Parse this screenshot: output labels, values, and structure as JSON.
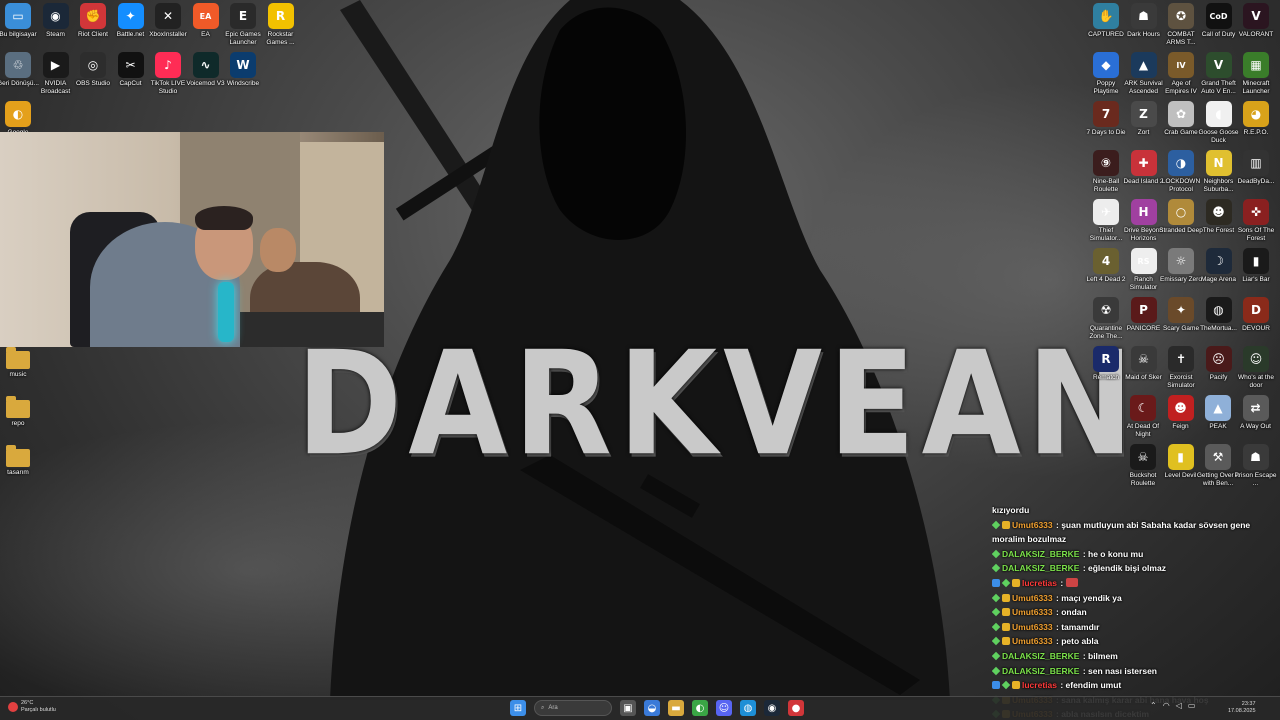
{
  "wallpaper": {
    "title": "DARKVEAN"
  },
  "desktop_left": [
    {
      "label": "Bu bilgisayar",
      "icon": "monitor-icon",
      "color": "#3a8ed8",
      "glyph": "▭"
    },
    {
      "label": "Steam",
      "icon": "steam-icon",
      "color": "#1b2838",
      "glyph": "◉"
    },
    {
      "label": "Riot Client",
      "icon": "riot-icon",
      "color": "#d13639",
      "glyph": "✊"
    },
    {
      "label": "Battle.net",
      "icon": "battlenet-icon",
      "color": "#148eff",
      "glyph": "✦"
    },
    {
      "label": "XboxInstaller",
      "icon": "xbox-icon",
      "color": "#222222",
      "glyph": "✕"
    },
    {
      "label": "EA",
      "icon": "ea-icon",
      "color": "#f05a28",
      "glyph": "EA"
    },
    {
      "label": "Epic Games Launcher",
      "icon": "epic-icon",
      "color": "#2a2a2a",
      "glyph": "E"
    },
    {
      "label": "Rockstar Games ...",
      "icon": "rockstar-icon",
      "color": "#f2c100",
      "glyph": "R"
    },
    {
      "label": "Geri Dönüşü...",
      "icon": "recycle-bin-icon",
      "color": "#5a6e80",
      "glyph": "♲"
    },
    {
      "label": "NVIDIA Broadcast",
      "icon": "nvidia-icon",
      "color": "#1a1a1a",
      "glyph": "▶"
    },
    {
      "label": "OBS Studio",
      "icon": "obs-icon",
      "color": "#2d2d2d",
      "glyph": "◎"
    },
    {
      "label": "CapCut",
      "icon": "capcut-icon",
      "color": "#111111",
      "glyph": "✂"
    },
    {
      "label": "TikTok LIVE Studio",
      "icon": "tiktok-icon",
      "color": "#ff2c55",
      "glyph": "♪"
    },
    {
      "label": "Voicemod V3",
      "icon": "voicemod-icon",
      "color": "#0f2a2a",
      "glyph": "∿"
    },
    {
      "label": "Windscribe",
      "icon": "windscribe-icon",
      "color": "#0b3c6e",
      "glyph": "W"
    },
    {
      "label": "Google",
      "icon": "chrome-icon",
      "color": "#e4a01b",
      "glyph": "◐"
    },
    {
      "label": "music",
      "icon": "folder-icon",
      "color": "#d9a93d",
      "glyph": ""
    },
    {
      "label": "repo",
      "icon": "folder-icon",
      "color": "#d9a93d",
      "glyph": ""
    },
    {
      "label": "tasarım",
      "icon": "folder-icon",
      "color": "#d9a93d",
      "glyph": ""
    }
  ],
  "desktop_right": [
    {
      "label": "CAPTURED",
      "icon": "captured-icon",
      "color": "#2f7fa0",
      "glyph": "✋"
    },
    {
      "label": "Dark Hours",
      "icon": "dark-hours-icon",
      "color": "#3a3a3a",
      "glyph": "☗"
    },
    {
      "label": "COMBAT ARMS T...",
      "icon": "combat-arms-icon",
      "color": "#5e5240",
      "glyph": "✪"
    },
    {
      "label": "Call of Duty",
      "icon": "cod-icon",
      "color": "#111111",
      "glyph": "CoD"
    },
    {
      "label": "VALORANT",
      "icon": "valorant-icon",
      "color": "#2b1520",
      "glyph": "V"
    },
    {
      "label": "Poppy Playtime",
      "icon": "poppy-icon",
      "color": "#2a6fd6",
      "glyph": "◆"
    },
    {
      "label": "ARK Survival Ascended",
      "icon": "ark-icon",
      "color": "#1b3a5c",
      "glyph": "▲"
    },
    {
      "label": "Age of Empires IV",
      "icon": "aoe-icon",
      "color": "#7a5a2a",
      "glyph": "IV"
    },
    {
      "label": "Grand Theft Auto V En...",
      "icon": "gta-icon",
      "color": "#2d4d2d",
      "glyph": "V"
    },
    {
      "label": "Minecraft Launcher",
      "icon": "minecraft-icon",
      "color": "#3a7d2a",
      "glyph": "▦"
    },
    {
      "label": "7 Days to Die",
      "icon": "7days-icon",
      "color": "#6a2a1e",
      "glyph": "7"
    },
    {
      "label": "Zort",
      "icon": "zort-icon",
      "color": "#4a4a4a",
      "glyph": "Z"
    },
    {
      "label": "Crab Game",
      "icon": "crab-game-icon",
      "color": "#bfbfbf",
      "glyph": "✿"
    },
    {
      "label": "Goose Goose Duck",
      "icon": "goose-icon",
      "color": "#f0f0f0",
      "glyph": "◖"
    },
    {
      "label": "R.E.P.O.",
      "icon": "repo-game-icon",
      "color": "#d8a21a",
      "glyph": "◕"
    },
    {
      "label": "Nine-Ball Roulette",
      "icon": "nineball-icon",
      "color": "#3b1d1d",
      "glyph": "⑨"
    },
    {
      "label": "Dead Island 2",
      "icon": "dead-island-icon",
      "color": "#c8323a",
      "glyph": "✚"
    },
    {
      "label": "LOCKDOWN Protocol",
      "icon": "lockdown-icon",
      "color": "#2c5fa0",
      "glyph": "◑"
    },
    {
      "label": "Neighbors Suburba...",
      "icon": "neighbors-icon",
      "color": "#e0c030",
      "glyph": "N"
    },
    {
      "label": "DeadByDa...",
      "icon": "dbd-icon",
      "color": "#333333",
      "glyph": "▥"
    },
    {
      "label": "Thief Simulator...",
      "icon": "thief-icon",
      "color": "#ededed",
      "glyph": "✈"
    },
    {
      "label": "Drive Beyond Horizons",
      "icon": "drive-beyond-icon",
      "color": "#a040a0",
      "glyph": "H"
    },
    {
      "label": "Stranded Deep",
      "icon": "stranded-icon",
      "color": "#b08a3a",
      "glyph": "○"
    },
    {
      "label": "The Forest",
      "icon": "forest-icon",
      "color": "#2d2a22",
      "glyph": "☻"
    },
    {
      "label": "Sons Of The Forest",
      "icon": "sons-forest-icon",
      "color": "#8a2020",
      "glyph": "✜"
    },
    {
      "label": "Left 4 Dead 2",
      "icon": "l4d2-icon",
      "color": "#6a6030",
      "glyph": "4"
    },
    {
      "label": "Ranch Simulator",
      "icon": "ranch-icon",
      "color": "#eeeeee",
      "glyph": "RS"
    },
    {
      "label": "Emissary Zero",
      "icon": "emissary-icon",
      "color": "#7a7a7a",
      "glyph": "☼"
    },
    {
      "label": "Mage Arena",
      "icon": "mage-arena-icon",
      "color": "#1e2a3a",
      "glyph": "☽"
    },
    {
      "label": "Liar's Bar",
      "icon": "liars-bar-icon",
      "color": "#1a1a1a",
      "glyph": "▮"
    },
    {
      "label": "Quarantine Zone The...",
      "icon": "quarantine-icon",
      "color": "#3a3a3a",
      "glyph": "☢"
    },
    {
      "label": "PANICORE",
      "icon": "panicore-icon",
      "color": "#5a1a1a",
      "glyph": "P"
    },
    {
      "label": "Scary Game",
      "icon": "scary-game-icon",
      "color": "#6a4a2a",
      "glyph": "✦"
    },
    {
      "label": "TheMortua...",
      "icon": "mortuary-icon",
      "color": "#1a1a1a",
      "glyph": "◍"
    },
    {
      "label": "DEVOUR",
      "icon": "devour-icon",
      "color": "#8a2a1a",
      "glyph": "D"
    },
    {
      "label": "Rematch",
      "icon": "rematch-icon",
      "color": "#1a2a6a",
      "glyph": "R"
    },
    {
      "label": "Maid of Sker",
      "icon": "maid-sker-icon",
      "color": "#3a3a3a",
      "glyph": "☠"
    },
    {
      "label": "Exorcist Simulator",
      "icon": "exorcist-icon",
      "color": "#2a2a2a",
      "glyph": "✝"
    },
    {
      "label": "Pacify",
      "icon": "pacify-icon",
      "color": "#4a1a1a",
      "glyph": "☹"
    },
    {
      "label": "Who's at the door",
      "icon": "whos-door-icon",
      "color": "#2a3a2a",
      "glyph": "☺"
    },
    {
      "label": "At Dead Of Night",
      "icon": "dead-night-icon",
      "color": "#6a1a1a",
      "glyph": "☾"
    },
    {
      "label": "Feign",
      "icon": "feign-icon",
      "color": "#c02020",
      "glyph": "☻"
    },
    {
      "label": "PEAK",
      "icon": "peak-icon",
      "color": "#8fb0d8",
      "glyph": "▲"
    },
    {
      "label": "A Way Out",
      "icon": "way-out-icon",
      "color": "#5a5a5a",
      "glyph": "⇄"
    },
    {
      "label": "Buckshot Roulette",
      "icon": "buckshot-icon",
      "color": "#1a1a1a",
      "glyph": "☠"
    },
    {
      "label": "Level Devil",
      "icon": "level-devil-icon",
      "color": "#e0c020",
      "glyph": "▮"
    },
    {
      "label": "Getting Over It with Ben...",
      "icon": "getting-over-icon",
      "color": "#5a5a5a",
      "glyph": "⚒"
    },
    {
      "label": "Prison Escape ...",
      "icon": "prison-escape-icon",
      "color": "#3a3a3a",
      "glyph": "☗"
    }
  ],
  "chat": [
    {
      "user": "",
      "text": "kızıyordu",
      "badges": [],
      "color": "#ffffff"
    },
    {
      "user": "Umut6333",
      "text": ": şuan mutluyum abi Sabaha kadar sövsen gene moralim bozulmaz",
      "badges": [
        "green",
        "gold"
      ],
      "color": "#f0a030"
    },
    {
      "user": "DALAKSIZ_BERKE",
      "text": ": he o konu mu",
      "badges": [
        "green"
      ],
      "color": "#7be04a"
    },
    {
      "user": "DALAKSIZ_BERKE",
      "text": ": eğlendik bişi olmaz",
      "badges": [
        "green"
      ],
      "color": "#7be04a"
    },
    {
      "user": "lucretias",
      "text": ":",
      "badges": [
        "blue",
        "green",
        "gold"
      ],
      "color": "#ff3a3a",
      "emote": true
    },
    {
      "user": "Umut6333",
      "text": ": maçı yendik ya",
      "badges": [
        "green",
        "gold"
      ],
      "color": "#f0a030"
    },
    {
      "user": "Umut6333",
      "text": ": ondan",
      "badges": [
        "green",
        "gold"
      ],
      "color": "#f0a030"
    },
    {
      "user": "Umut6333",
      "text": ": tamamdır",
      "badges": [
        "green",
        "gold"
      ],
      "color": "#f0a030"
    },
    {
      "user": "Umut6333",
      "text": ": peto abla",
      "badges": [
        "green",
        "gold"
      ],
      "color": "#f0a030"
    },
    {
      "user": "DALAKSIZ_BERKE",
      "text": ": bilmem",
      "badges": [
        "green"
      ],
      "color": "#7be04a"
    },
    {
      "user": "DALAKSIZ_BERKE",
      "text": ": sen nası istersen",
      "badges": [
        "green"
      ],
      "color": "#7be04a"
    },
    {
      "user": "lucretias",
      "text": ": efendim umut",
      "badges": [
        "blue",
        "green",
        "gold"
      ],
      "color": "#ff3a3a"
    },
    {
      "user": "Umut6333",
      "text": ": sana kalmış karar abi bana hava hoş",
      "badges": [
        "green",
        "gold"
      ],
      "color": "#f0a030"
    },
    {
      "user": "Umut6333",
      "text": ": abla nasılsın dicektim",
      "badges": [
        "green",
        "gold"
      ],
      "color": "#f0a030"
    }
  ],
  "taskbar": {
    "weather_temp": "26°C",
    "weather_desc": "Parçalı bulutlu",
    "search_placeholder": "Ara",
    "time": "23:37",
    "date": "17.08.2025",
    "apps": [
      {
        "name": "start-button",
        "glyph": "⊞",
        "color": "#3c8ee8"
      },
      {
        "name": "taskview-button",
        "glyph": "▣",
        "color": "#555555"
      },
      {
        "name": "widgets-button",
        "glyph": "◒",
        "color": "#3a7ad8"
      },
      {
        "name": "file-explorer-button",
        "glyph": "▬",
        "color": "#d9a93d"
      },
      {
        "name": "chrome-button",
        "glyph": "◐",
        "color": "#3aa545"
      },
      {
        "name": "discord-button",
        "glyph": "☺",
        "color": "#5865f2"
      },
      {
        "name": "edge-button",
        "glyph": "◍",
        "color": "#1e8fd6"
      },
      {
        "name": "steam-button",
        "glyph": "◉",
        "color": "#1b2838"
      },
      {
        "name": "record-button",
        "glyph": "●",
        "color": "#d13639"
      }
    ]
  }
}
